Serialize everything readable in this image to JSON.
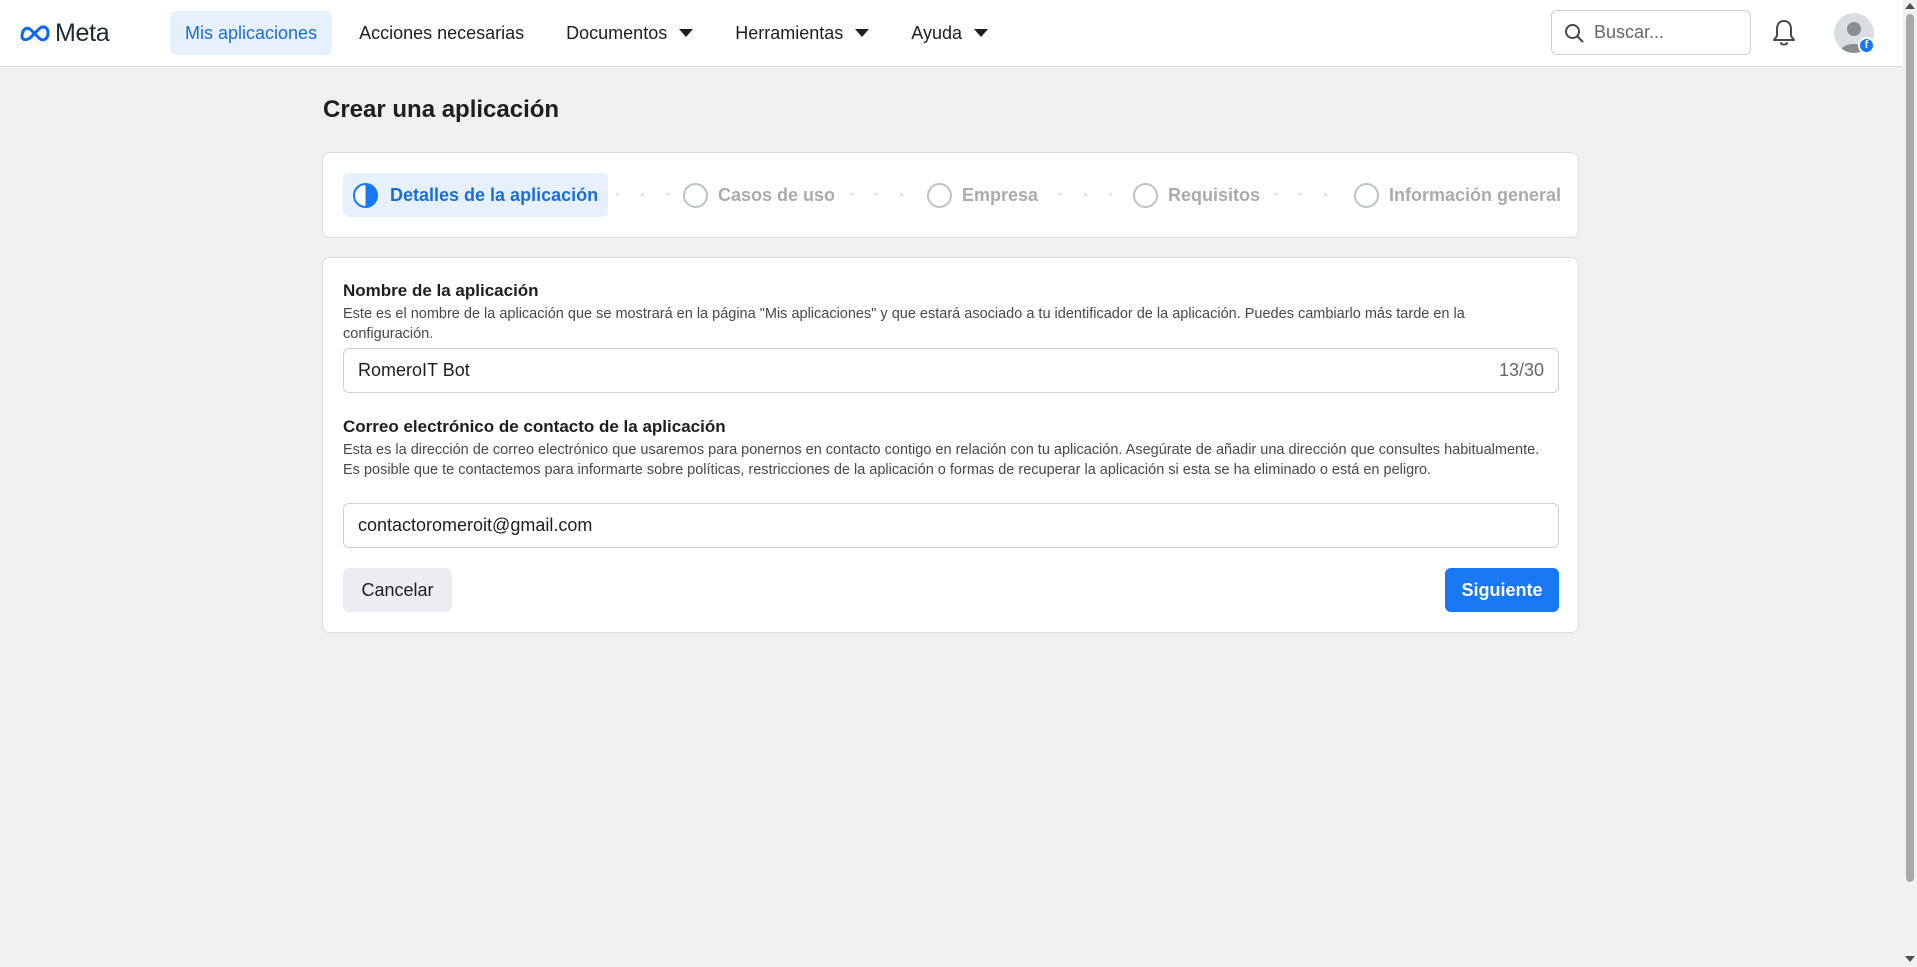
{
  "brand": {
    "name": "Meta",
    "logo_icon": "meta-infinity-icon",
    "color": "#0866ff"
  },
  "nav": {
    "items": [
      {
        "label": "Mis aplicaciones",
        "active": true,
        "has_dropdown": false
      },
      {
        "label": "Acciones necesarias",
        "active": false,
        "has_dropdown": false
      },
      {
        "label": "Documentos",
        "active": false,
        "has_dropdown": true
      },
      {
        "label": "Herramientas",
        "active": false,
        "has_dropdown": true
      },
      {
        "label": "Ayuda",
        "active": false,
        "has_dropdown": true
      }
    ]
  },
  "search": {
    "placeholder": "Buscar...",
    "value": ""
  },
  "page": {
    "title": "Crear una aplicación"
  },
  "stepper": {
    "steps": [
      {
        "label": "Detalles de la aplicación",
        "state": "current"
      },
      {
        "label": "Casos de uso",
        "state": "pending"
      },
      {
        "label": "Empresa",
        "state": "pending"
      },
      {
        "label": "Requisitos",
        "state": "pending"
      },
      {
        "label": "Información general",
        "state": "pending"
      }
    ]
  },
  "form": {
    "app_name": {
      "label": "Nombre de la aplicación",
      "help": "Este es el nombre de la aplicación que se mostrará en la página \"Mis aplicaciones\" y que estará asociado a tu identificador de la aplicación. Puedes cambiarlo más tarde en la configuración.",
      "value": "RomeroIT Bot",
      "counter": "13/30"
    },
    "contact_email": {
      "label": "Correo electrónico de contacto de la aplicación",
      "help": "Esta es la dirección de correo electrónico que usaremos para ponernos en contacto contigo en relación con tu aplicación. Asegúrate de añadir una dirección que consultes habitualmente. Es posible que te contactemos para informarte sobre políticas, restricciones de la aplicación o formas de recuperar la aplicación si esta se ha eliminado o está en peligro.",
      "value": "contactoromeroit@gmail.com"
    },
    "cancel_label": "Cancelar",
    "next_label": "Siguiente"
  },
  "colors": {
    "accent": "#1877f2",
    "active_nav_bg": "#e7f0fd",
    "page_bg": "#f0f0f0"
  }
}
